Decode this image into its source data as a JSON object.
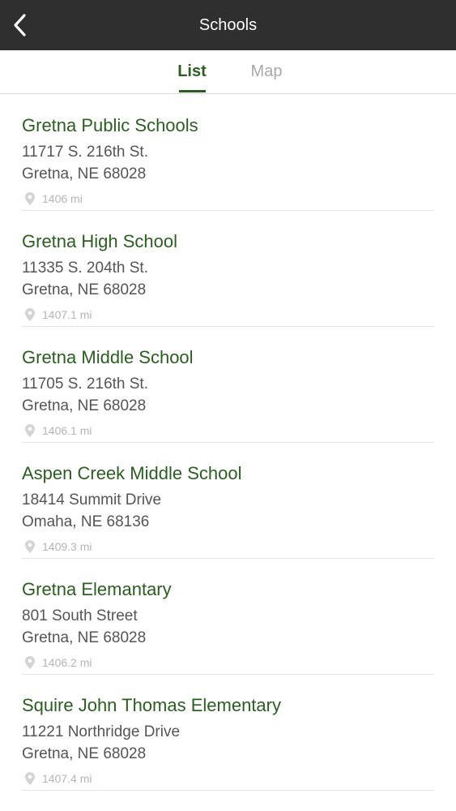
{
  "header": {
    "title": "Schools",
    "back_icon": "chevron-left-icon"
  },
  "tabs": [
    {
      "label": "List",
      "active": true
    },
    {
      "label": "Map",
      "active": false
    }
  ],
  "colors": {
    "header_bg": "#2f2f2f",
    "accent": "#2c5d22",
    "inactive_tab": "#a9a9a9",
    "distance_text": "#b5b5b5"
  },
  "schools": [
    {
      "name": "Gretna Public Schools",
      "address1": "11717 S. 216th St.",
      "address2": "Gretna, NE 68028",
      "distance": "1406 mi"
    },
    {
      "name": "Gretna High School",
      "address1": "11335 S. 204th St.",
      "address2": "Gretna, NE 68028",
      "distance": "1407.1 mi"
    },
    {
      "name": "Gretna Middle School",
      "address1": "11705 S. 216th St.",
      "address2": "Gretna, NE 68028",
      "distance": "1406.1 mi"
    },
    {
      "name": "Aspen Creek Middle School",
      "address1": "18414 Summit Drive",
      "address2": "Omaha, NE 68136",
      "distance": "1409.3 mi"
    },
    {
      "name": "Gretna Elemantary",
      "address1": "801 South Street",
      "address2": "Gretna, NE 68028",
      "distance": "1406.2 mi"
    },
    {
      "name": "Squire John Thomas Elementary",
      "address1": "11221 Northridge Drive",
      "address2": "Gretna, NE 68028",
      "distance": "1407.4 mi"
    }
  ]
}
